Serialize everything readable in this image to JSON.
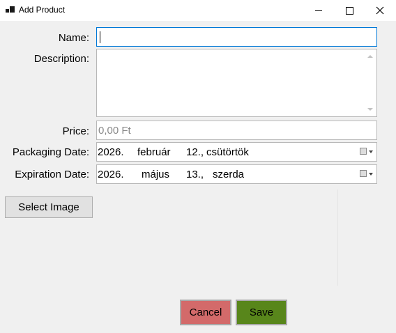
{
  "window": {
    "title": "Add Product"
  },
  "form": {
    "name_label": "Name:",
    "name_value": "",
    "description_label": "Description:",
    "description_value": "",
    "price_label": "Price:",
    "price_placeholder": "0,00 Ft",
    "packaging_label": "Packaging Date:",
    "packaging_date": {
      "year": "2026.",
      "month": "február",
      "day": "12.,",
      "weekday": "csütörtök"
    },
    "expiration_label": "Expiration Date:",
    "expiration_date": {
      "year": "2026.",
      "month": "május",
      "day": "13.,",
      "weekday": "szerda"
    }
  },
  "buttons": {
    "select_image": "Select Image",
    "cancel": "Cancel",
    "save": "Save"
  },
  "colors": {
    "cancel_bg": "#d36a6a",
    "save_bg": "#58861b",
    "focus_border": "#0078d7"
  }
}
